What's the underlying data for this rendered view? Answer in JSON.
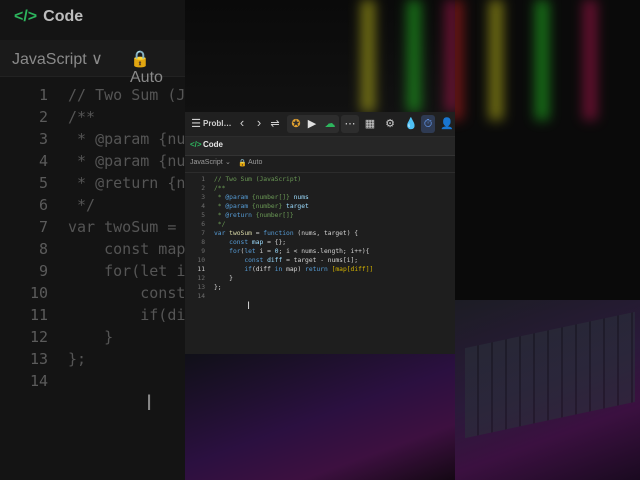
{
  "background": {
    "left_title": "Code",
    "left_language": "JavaScript",
    "left_chevron": "∨",
    "left_auto": "Auto",
    "left_lines": [
      {
        "n": "1",
        "t": "// Two Sum (Ja"
      },
      {
        "n": "2",
        "t": "/**"
      },
      {
        "n": "3",
        "t": " * @param {num"
      },
      {
        "n": "4",
        "t": " * @param {num"
      },
      {
        "n": "5",
        "t": " * @return {nu"
      },
      {
        "n": "6",
        "t": " */"
      },
      {
        "n": "7",
        "t": "var twoSum = f"
      },
      {
        "n": "8",
        "t": "    const map"
      },
      {
        "n": "9",
        "t": "    for(let i"
      },
      {
        "n": "10",
        "t": "        const"
      },
      {
        "n": "11",
        "t": "        if(dif"
      },
      {
        "n": "12",
        "t": "    }"
      },
      {
        "n": "13",
        "t": "};"
      },
      {
        "n": "14",
        "t": ""
      }
    ]
  },
  "toolbar": {
    "problem_tab": "Probl…",
    "prev_icon": "‹",
    "next_icon": "›"
  },
  "panel": {
    "title": "Code",
    "language": "JavaScript",
    "auto": "Auto",
    "lines": [
      {
        "n": "1"
      },
      {
        "n": "2"
      },
      {
        "n": "3"
      },
      {
        "n": "4"
      },
      {
        "n": "5"
      },
      {
        "n": "6"
      },
      {
        "n": "7"
      },
      {
        "n": "8"
      },
      {
        "n": "9"
      },
      {
        "n": "10"
      },
      {
        "n": "11"
      },
      {
        "n": "12"
      },
      {
        "n": "13"
      },
      {
        "n": "14"
      }
    ],
    "code": {
      "l1": "// Two Sum (JavaScript)",
      "l2": "/**",
      "l3a": " * ",
      "l3b": "@param",
      "l3c": " {number[]} ",
      "l3d": "nums",
      "l4a": " * ",
      "l4b": "@param",
      "l4c": " {number} ",
      "l4d": "target",
      "l5a": " * ",
      "l5b": "@return",
      "l5c": " {number[]}",
      "l6": " */",
      "l7a": "var",
      "l7b": " twoSum",
      "l7c": " = ",
      "l7d": "function",
      "l7e": " (nums, target) {",
      "l8a": "    ",
      "l8b": "const",
      "l8c": " map",
      "l8d": " = {};",
      "l9a": "    ",
      "l9b": "for",
      "l9c": "(",
      "l9d": "let",
      "l9e": " i = ",
      "l9f": "0",
      "l9g": "; i < nums.length; i++){",
      "l10a": "        ",
      "l10b": "const",
      "l10c": " diff",
      "l10d": " = target - nums[i];",
      "l11a": "        ",
      "l11b": "if",
      "l11c": "(diff ",
      "l11d": "in",
      "l11e": " map) ",
      "l11f": "return",
      "l11g": " [map[diff]]",
      "l12": "    }",
      "l13": "};",
      "l14": ""
    }
  },
  "colors": {
    "comment": "#6a9955",
    "keyword": "#569cd6",
    "accent_green": "#2db55d",
    "editor_bg": "#1e1e1e"
  }
}
